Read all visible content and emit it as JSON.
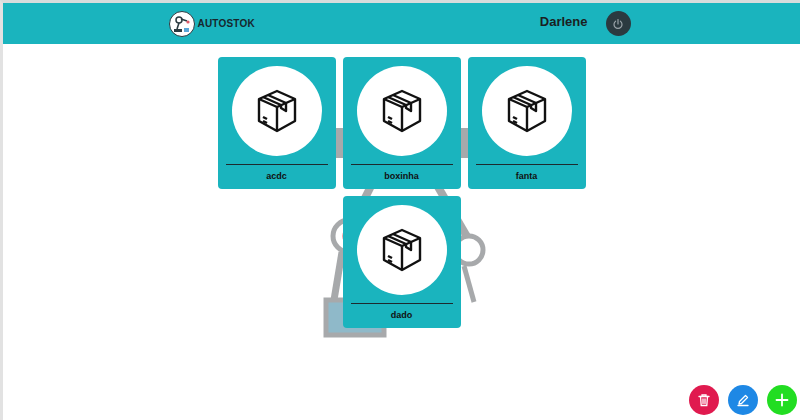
{
  "header": {
    "logo_text": "AUTOSTOK",
    "user_name": "Darlene"
  },
  "items": [
    {
      "label": "acdc"
    },
    {
      "label": "boxinha"
    },
    {
      "label": "fanta"
    },
    {
      "label": "dado"
    }
  ]
}
